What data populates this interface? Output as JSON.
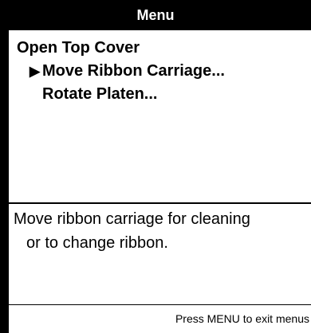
{
  "header": {
    "title": "Menu"
  },
  "menu": {
    "items": [
      {
        "label": "Open Top Cover",
        "selected": false
      },
      {
        "label": "Move Ribbon Carriage...",
        "selected": true,
        "marker": "▶"
      },
      {
        "label": "Rotate Platen...",
        "selected": false
      }
    ]
  },
  "description": {
    "line1": "Move ribbon carriage for cleaning",
    "line2": "or to change ribbon."
  },
  "footer": {
    "hint": "Press MENU to exit menus"
  },
  "colors": {
    "background": "#000000",
    "panel": "#ffffff",
    "text": "#000000",
    "header_text": "#ffffff"
  }
}
